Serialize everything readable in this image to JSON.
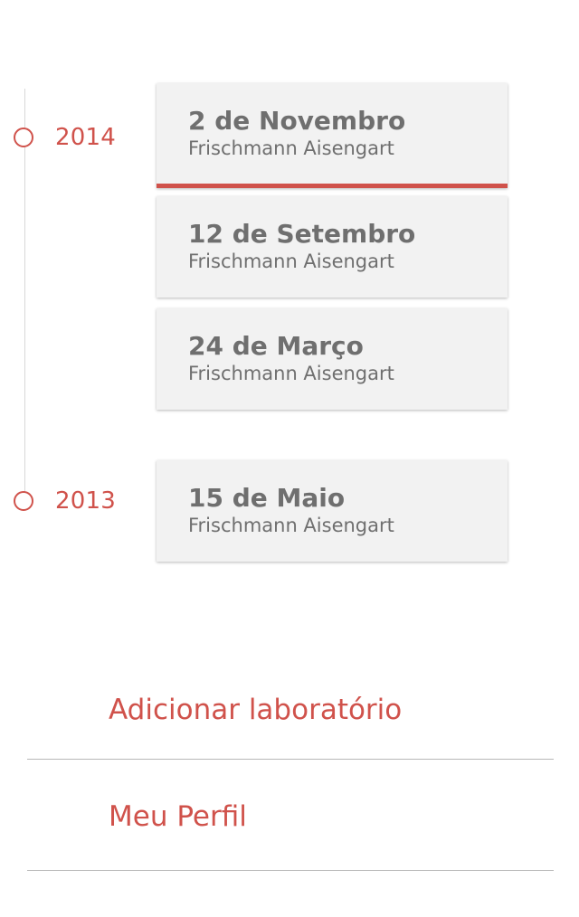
{
  "timeline": {
    "years": [
      {
        "year": "2014",
        "entries": [
          {
            "date": "2 de Novembro",
            "name": "Frischmann Aisengart",
            "active": true
          },
          {
            "date": "12 de Setembro",
            "name": "Frischmann Aisengart",
            "active": false
          },
          {
            "date": "24 de Março",
            "name": "Frischmann Aisengart",
            "active": false
          }
        ]
      },
      {
        "year": "2013",
        "entries": [
          {
            "date": "15 de Maio",
            "name": "Frischmann Aisengart",
            "active": false
          }
        ]
      }
    ]
  },
  "menu": {
    "add_lab": "Adicionar laboratório",
    "profile": "Meu Perfil"
  },
  "colors": {
    "accent": "#d0524b",
    "card_bg": "#f2f2f2",
    "card_text": "#6f6f6f"
  }
}
